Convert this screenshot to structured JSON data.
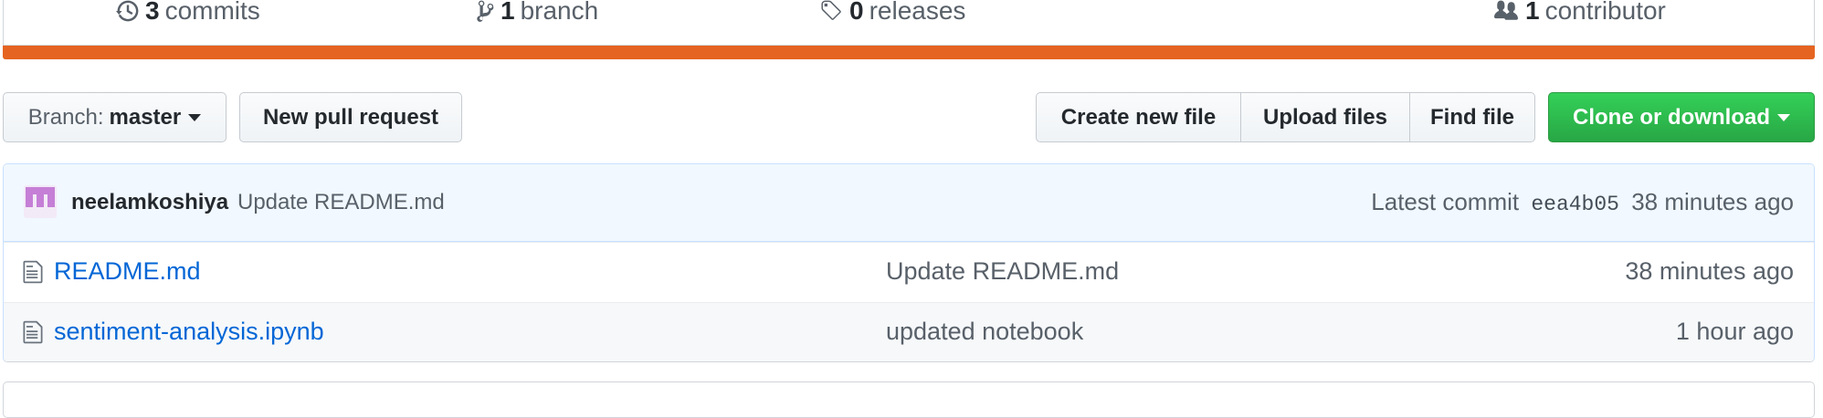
{
  "summary": {
    "commits": {
      "count": "3",
      "label": "commits",
      "icon": "history-icon"
    },
    "branches": {
      "count": "1",
      "label": "branch",
      "icon": "git-branch-icon"
    },
    "releases": {
      "count": "0",
      "label": "releases",
      "icon": "tag-icon"
    },
    "contributors": {
      "count": "1",
      "label": "contributor",
      "icon": "people-icon"
    },
    "language_color": "#e56421"
  },
  "toolbar": {
    "branch_prefix": "Branch:",
    "branch_name": "master",
    "new_pull_request": "New pull request",
    "create_new_file": "Create new file",
    "upload_files": "Upload files",
    "find_file": "Find file",
    "clone_or_download": "Clone or download"
  },
  "latest_commit": {
    "author": "neelamkoshiya",
    "message": "Update README.md",
    "prefix": "Latest commit",
    "sha": "eea4b05",
    "age": "38 minutes ago"
  },
  "files": [
    {
      "name": "README.md",
      "message": "Update README.md",
      "age": "38 minutes ago",
      "icon": "file-icon"
    },
    {
      "name": "sentiment-analysis.ipynb",
      "message": "updated notebook",
      "age": "1 hour ago",
      "icon": "file-icon"
    }
  ],
  "colors": {
    "accent_green": "#28a745",
    "link_blue": "#0366d6",
    "commit_bg": "#f1f8ff"
  }
}
